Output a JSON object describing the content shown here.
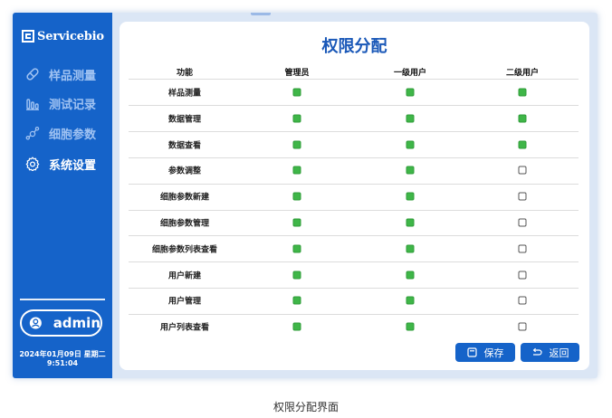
{
  "brand": {
    "name": "Servicebio"
  },
  "sidebar": {
    "items": [
      {
        "label": "样品测量",
        "icon": "flask-icon"
      },
      {
        "label": "测试记录",
        "icon": "bar-chart-icon"
      },
      {
        "label": "细胞参数",
        "icon": "cell-icon"
      },
      {
        "label": "系统设置",
        "icon": "gear-icon",
        "active": true
      }
    ],
    "user": "admin",
    "date": "2024年01月09日 星期二",
    "time": "9:51:04"
  },
  "page": {
    "title": "权限分配",
    "columns": [
      "功能",
      "管理员",
      "一级用户",
      "二级用户"
    ],
    "rows": [
      {
        "name": "样品测量",
        "admin": true,
        "level1": true,
        "level2": true
      },
      {
        "name": "数据管理",
        "admin": true,
        "level1": true,
        "level2": true
      },
      {
        "name": "数据查看",
        "admin": true,
        "level1": true,
        "level2": true
      },
      {
        "name": "参数调整",
        "admin": true,
        "level1": true,
        "level2": false
      },
      {
        "name": "细胞参数新建",
        "admin": true,
        "level1": true,
        "level2": false
      },
      {
        "name": "细胞参数管理",
        "admin": true,
        "level1": true,
        "level2": false
      },
      {
        "name": "细胞参数列表查看",
        "admin": true,
        "level1": true,
        "level2": false
      },
      {
        "name": "用户新建",
        "admin": true,
        "level1": true,
        "level2": false
      },
      {
        "name": "用户管理",
        "admin": true,
        "level1": true,
        "level2": false
      },
      {
        "name": "用户列表查看",
        "admin": true,
        "level1": true,
        "level2": false
      }
    ],
    "save_label": "保存",
    "back_label": "返回"
  },
  "caption": "权限分配界面",
  "colors": {
    "primary": "#1563c9",
    "checked": "#3fb648",
    "title": "#1a58b8"
  }
}
